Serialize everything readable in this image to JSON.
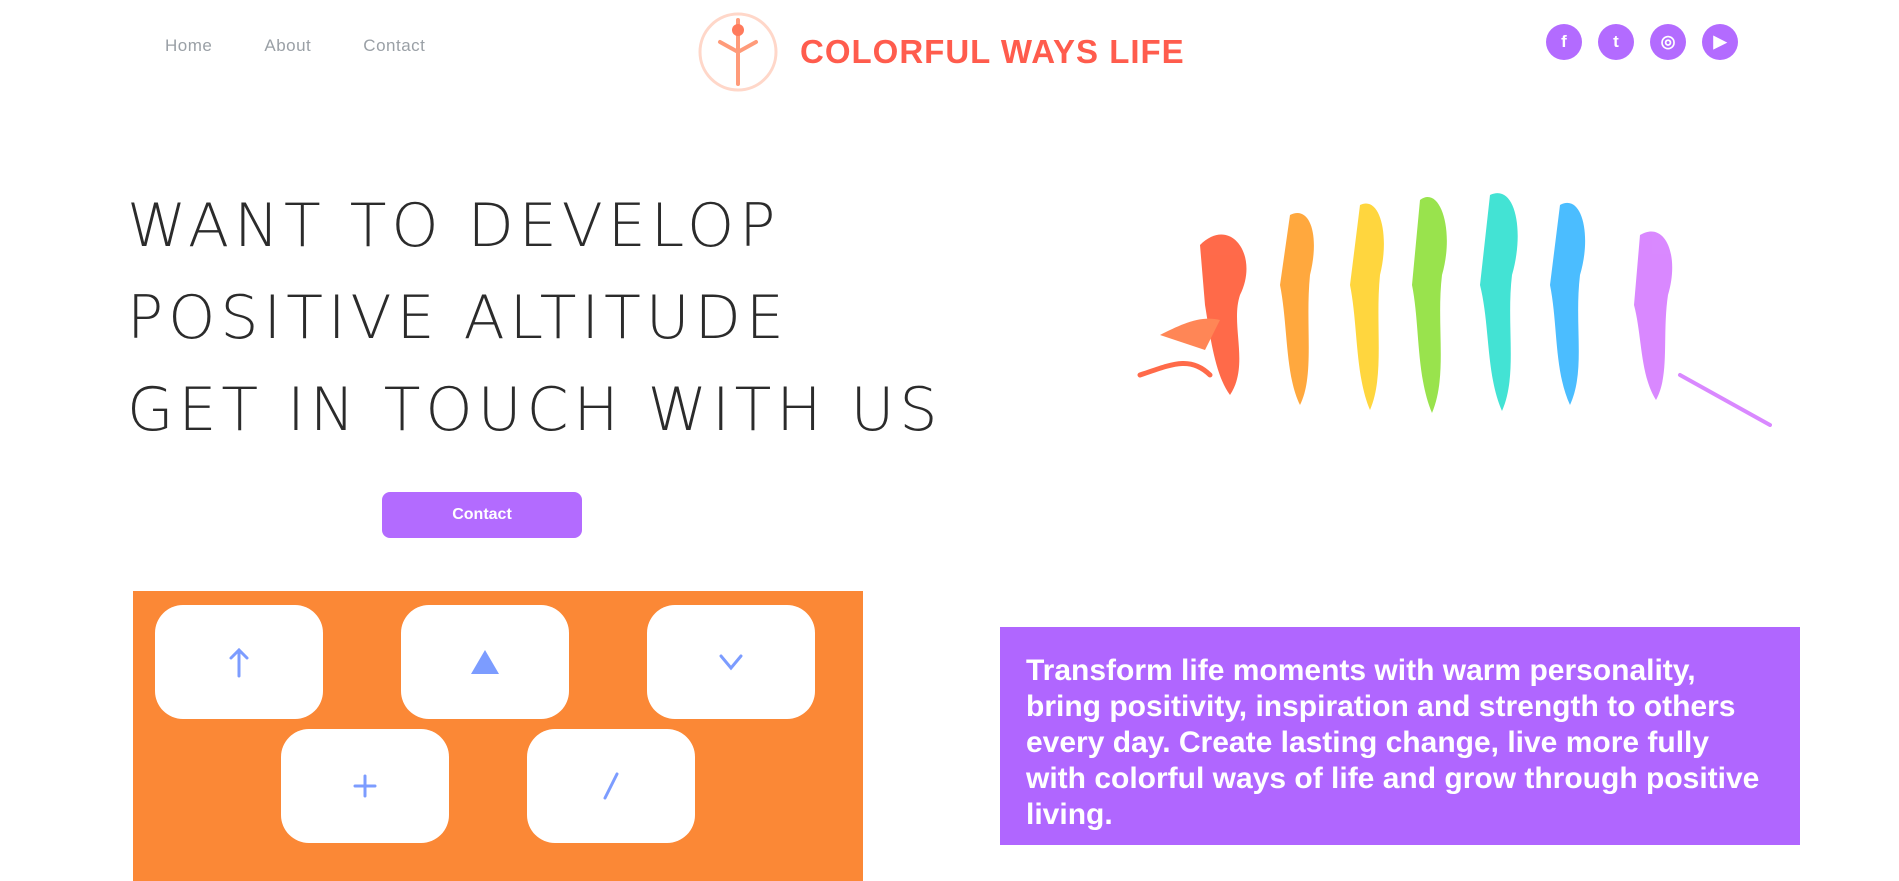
{
  "header": {
    "nav": [
      {
        "label": "Home"
      },
      {
        "label": "About"
      },
      {
        "label": "Contact"
      }
    ],
    "brand_text": "COLORFUL WAYS LIFE",
    "social": [
      {
        "icon": "facebook-icon",
        "glyph": "f"
      },
      {
        "icon": "twitter-icon",
        "glyph": "t"
      },
      {
        "icon": "instagram-icon",
        "glyph": "◎"
      },
      {
        "icon": "youtube-icon",
        "glyph": "▶"
      }
    ]
  },
  "hero": {
    "lines": [
      "WANT TO DEVELOP",
      "POSITIVE ALTITUDE",
      "GET IN TOUCH WITH US"
    ],
    "cta_label": "Contact"
  },
  "features": {
    "tiles": [
      {
        "icon": "arrow-up-icon"
      },
      {
        "icon": "triangle-icon"
      },
      {
        "icon": "chevron-down-icon"
      },
      {
        "icon": "plus-icon"
      },
      {
        "icon": "slash-icon"
      }
    ]
  },
  "quote": {
    "text": "Transform life moments with warm personality, bring positivity, inspiration and strength to others every day. Create lasting change, live more fully with colorful ways of life and grow through positive living."
  },
  "colors": {
    "accent": "#b36bff",
    "orange": "#fb8836",
    "brand": "#ff5c4d"
  }
}
